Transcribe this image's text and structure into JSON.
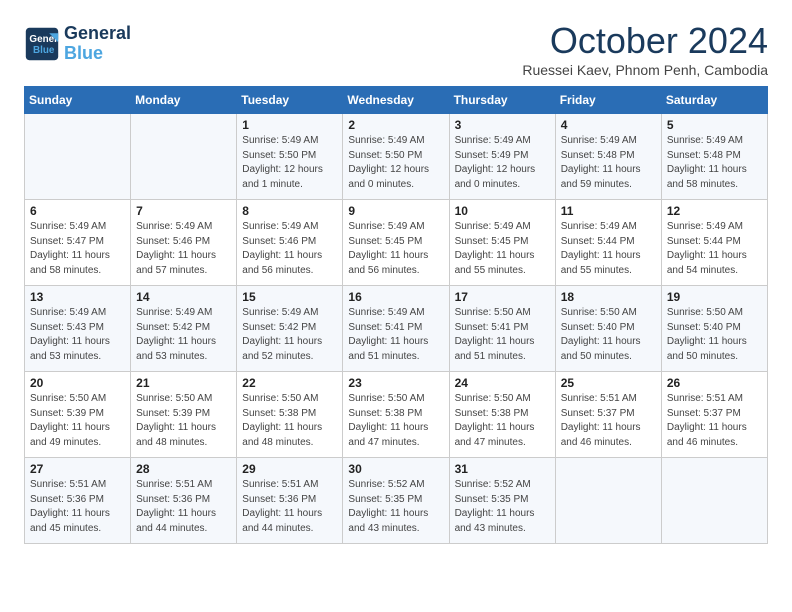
{
  "logo": {
    "line1": "General",
    "line2": "Blue"
  },
  "title": "October 2024",
  "subtitle": "Ruessei Kaev, Phnom Penh, Cambodia",
  "headers": [
    "Sunday",
    "Monday",
    "Tuesday",
    "Wednesday",
    "Thursday",
    "Friday",
    "Saturday"
  ],
  "weeks": [
    [
      {
        "day": "",
        "detail": ""
      },
      {
        "day": "",
        "detail": ""
      },
      {
        "day": "1",
        "detail": "Sunrise: 5:49 AM\nSunset: 5:50 PM\nDaylight: 12 hours\nand 1 minute."
      },
      {
        "day": "2",
        "detail": "Sunrise: 5:49 AM\nSunset: 5:50 PM\nDaylight: 12 hours\nand 0 minutes."
      },
      {
        "day": "3",
        "detail": "Sunrise: 5:49 AM\nSunset: 5:49 PM\nDaylight: 12 hours\nand 0 minutes."
      },
      {
        "day": "4",
        "detail": "Sunrise: 5:49 AM\nSunset: 5:48 PM\nDaylight: 11 hours\nand 59 minutes."
      },
      {
        "day": "5",
        "detail": "Sunrise: 5:49 AM\nSunset: 5:48 PM\nDaylight: 11 hours\nand 58 minutes."
      }
    ],
    [
      {
        "day": "6",
        "detail": "Sunrise: 5:49 AM\nSunset: 5:47 PM\nDaylight: 11 hours\nand 58 minutes."
      },
      {
        "day": "7",
        "detail": "Sunrise: 5:49 AM\nSunset: 5:46 PM\nDaylight: 11 hours\nand 57 minutes."
      },
      {
        "day": "8",
        "detail": "Sunrise: 5:49 AM\nSunset: 5:46 PM\nDaylight: 11 hours\nand 56 minutes."
      },
      {
        "day": "9",
        "detail": "Sunrise: 5:49 AM\nSunset: 5:45 PM\nDaylight: 11 hours\nand 56 minutes."
      },
      {
        "day": "10",
        "detail": "Sunrise: 5:49 AM\nSunset: 5:45 PM\nDaylight: 11 hours\nand 55 minutes."
      },
      {
        "day": "11",
        "detail": "Sunrise: 5:49 AM\nSunset: 5:44 PM\nDaylight: 11 hours\nand 55 minutes."
      },
      {
        "day": "12",
        "detail": "Sunrise: 5:49 AM\nSunset: 5:44 PM\nDaylight: 11 hours\nand 54 minutes."
      }
    ],
    [
      {
        "day": "13",
        "detail": "Sunrise: 5:49 AM\nSunset: 5:43 PM\nDaylight: 11 hours\nand 53 minutes."
      },
      {
        "day": "14",
        "detail": "Sunrise: 5:49 AM\nSunset: 5:42 PM\nDaylight: 11 hours\nand 53 minutes."
      },
      {
        "day": "15",
        "detail": "Sunrise: 5:49 AM\nSunset: 5:42 PM\nDaylight: 11 hours\nand 52 minutes."
      },
      {
        "day": "16",
        "detail": "Sunrise: 5:49 AM\nSunset: 5:41 PM\nDaylight: 11 hours\nand 51 minutes."
      },
      {
        "day": "17",
        "detail": "Sunrise: 5:50 AM\nSunset: 5:41 PM\nDaylight: 11 hours\nand 51 minutes."
      },
      {
        "day": "18",
        "detail": "Sunrise: 5:50 AM\nSunset: 5:40 PM\nDaylight: 11 hours\nand 50 minutes."
      },
      {
        "day": "19",
        "detail": "Sunrise: 5:50 AM\nSunset: 5:40 PM\nDaylight: 11 hours\nand 50 minutes."
      }
    ],
    [
      {
        "day": "20",
        "detail": "Sunrise: 5:50 AM\nSunset: 5:39 PM\nDaylight: 11 hours\nand 49 minutes."
      },
      {
        "day": "21",
        "detail": "Sunrise: 5:50 AM\nSunset: 5:39 PM\nDaylight: 11 hours\nand 48 minutes."
      },
      {
        "day": "22",
        "detail": "Sunrise: 5:50 AM\nSunset: 5:38 PM\nDaylight: 11 hours\nand 48 minutes."
      },
      {
        "day": "23",
        "detail": "Sunrise: 5:50 AM\nSunset: 5:38 PM\nDaylight: 11 hours\nand 47 minutes."
      },
      {
        "day": "24",
        "detail": "Sunrise: 5:50 AM\nSunset: 5:38 PM\nDaylight: 11 hours\nand 47 minutes."
      },
      {
        "day": "25",
        "detail": "Sunrise: 5:51 AM\nSunset: 5:37 PM\nDaylight: 11 hours\nand 46 minutes."
      },
      {
        "day": "26",
        "detail": "Sunrise: 5:51 AM\nSunset: 5:37 PM\nDaylight: 11 hours\nand 46 minutes."
      }
    ],
    [
      {
        "day": "27",
        "detail": "Sunrise: 5:51 AM\nSunset: 5:36 PM\nDaylight: 11 hours\nand 45 minutes."
      },
      {
        "day": "28",
        "detail": "Sunrise: 5:51 AM\nSunset: 5:36 PM\nDaylight: 11 hours\nand 44 minutes."
      },
      {
        "day": "29",
        "detail": "Sunrise: 5:51 AM\nSunset: 5:36 PM\nDaylight: 11 hours\nand 44 minutes."
      },
      {
        "day": "30",
        "detail": "Sunrise: 5:52 AM\nSunset: 5:35 PM\nDaylight: 11 hours\nand 43 minutes."
      },
      {
        "day": "31",
        "detail": "Sunrise: 5:52 AM\nSunset: 5:35 PM\nDaylight: 11 hours\nand 43 minutes."
      },
      {
        "day": "",
        "detail": ""
      },
      {
        "day": "",
        "detail": ""
      }
    ]
  ]
}
